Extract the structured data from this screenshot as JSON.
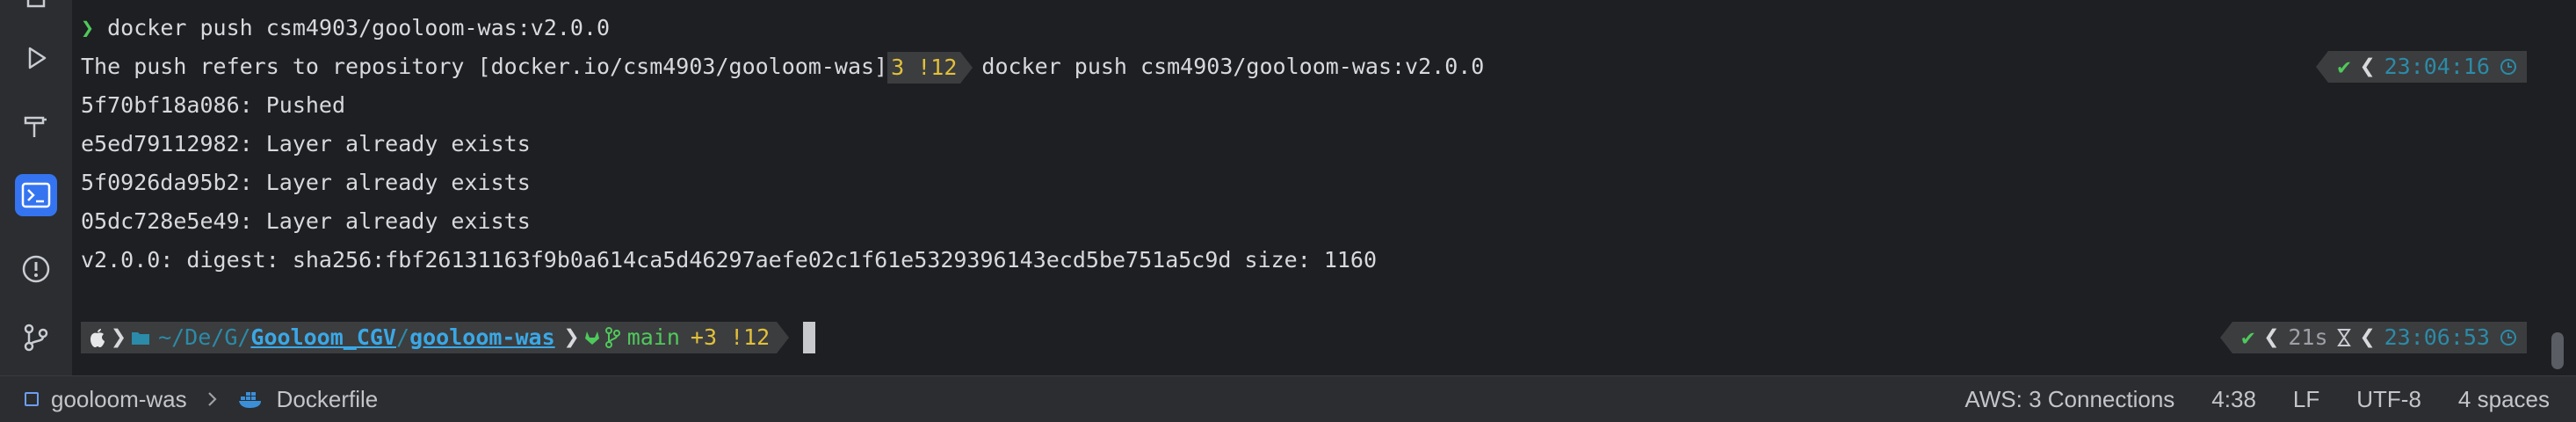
{
  "terminal": {
    "line0": {
      "command": "docker push csm4903/gooloom-was:v2.0.0"
    },
    "line1": {
      "output": "The push refers to repository [docker.io/csm4903/gooloom-was]",
      "git_status": "3 !12",
      "command": "docker push csm4903/gooloom-was:v2.0.0"
    },
    "lines": [
      "5f70bf18a086: Pushed",
      "e5ed79112982: Layer already exists",
      "5f0926da95b2: Layer already exists",
      "05dc728e5e49: Layer already exists",
      "v2.0.0: digest: sha256:fbf26131163f9b0a614ca5d46297aefe02c1f61e5329396143ecd5be751a5c9d size: 1160"
    ],
    "status1": {
      "check": "✔",
      "time": "23:04:16"
    },
    "prompt": {
      "path_prefix": "~/De/G/",
      "path_dir1": "Gooloom_CGV",
      "path_sep": "/",
      "path_dir2": "gooloom-was",
      "branch": "main",
      "changes": "+3 !12"
    },
    "status2": {
      "check": "✔",
      "duration": "21s",
      "time": "23:06:53"
    }
  },
  "statusbar": {
    "project": "gooloom-was",
    "file": "Dockerfile",
    "aws": "AWS: 3 Connections",
    "position": "4:38",
    "line_sep": "LF",
    "encoding": "UTF-8",
    "indent": "4 spaces"
  },
  "icons": {
    "sidebar": [
      "run-icon",
      "build-hammer-icon",
      "terminal-icon",
      "problems-icon",
      "git-icon"
    ]
  }
}
